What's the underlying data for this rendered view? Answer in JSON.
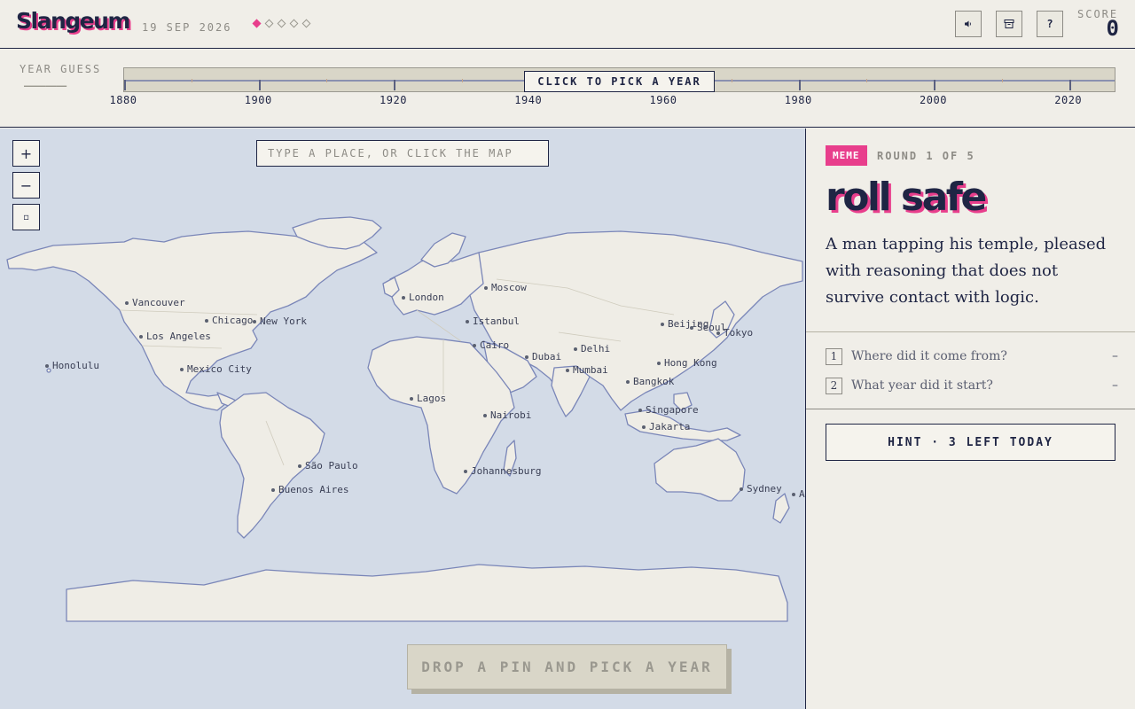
{
  "app": {
    "title": "Slangeum",
    "date": "19 SEP 2026",
    "progress_current_round": 1,
    "progress_total_rounds": 5
  },
  "header": {
    "sound_icon": "speaker-icon",
    "archive_icon": "archive-box-icon",
    "help_label": "?",
    "score_label": "SCORE",
    "score_value": "0"
  },
  "timeline": {
    "label": "YEAR GUESS",
    "value_placeholder": "————",
    "pick_button": "CLICK TO PICK A YEAR",
    "start_year": 1880,
    "end_year": 2027,
    "year_labels": [
      "1880",
      "1900",
      "1920",
      "1940",
      "1960",
      "1980",
      "2000",
      "2020"
    ]
  },
  "map": {
    "search_placeholder": "TYPE A PLACE, OR CLICK THE MAP",
    "zoom_in_label": "+",
    "zoom_out_label": "−",
    "reset_label": "▫",
    "drop_button": "DROP A PIN AND PICK A YEAR",
    "cities": [
      {
        "name": "Vancouver"
      },
      {
        "name": "Chicago"
      },
      {
        "name": "New York"
      },
      {
        "name": "Los Angeles"
      },
      {
        "name": "Honolulu"
      },
      {
        "name": "Mexico City"
      },
      {
        "name": "London"
      },
      {
        "name": "Moscow"
      },
      {
        "name": "Istanbul"
      },
      {
        "name": "Cairo"
      },
      {
        "name": "Dubai"
      },
      {
        "name": "Delhi"
      },
      {
        "name": "Mumbai"
      },
      {
        "name": "Beijing"
      },
      {
        "name": "Seoul"
      },
      {
        "name": "Tokyo"
      },
      {
        "name": "Hong Kong"
      },
      {
        "name": "Bangkok"
      },
      {
        "name": "Singapore"
      },
      {
        "name": "Jakarta"
      },
      {
        "name": "Lagos"
      },
      {
        "name": "Nairobi"
      },
      {
        "name": "Johannesburg"
      },
      {
        "name": "São Paulo"
      },
      {
        "name": "Buenos Aires"
      },
      {
        "name": "Sydney"
      },
      {
        "name": "A"
      }
    ]
  },
  "panel": {
    "tag": "MEME",
    "round": "ROUND 1 OF 5",
    "title": "roll safe",
    "description": "A man tapping his temple, pleased with reasoning that does not survive contact with logic.",
    "questions": [
      {
        "num": "1",
        "text": "Where did it come from?",
        "status": "–"
      },
      {
        "num": "2",
        "text": "What year did it start?",
        "status": "–"
      }
    ],
    "hint_button": "HINT · 3 LEFT TODAY"
  },
  "colors": {
    "accent": "#e83e8c",
    "ink": "#1f2544",
    "paper": "#f0eee8",
    "ocean": "#d3dbe7",
    "land": "#efede6",
    "coast": "#7a86b8"
  }
}
